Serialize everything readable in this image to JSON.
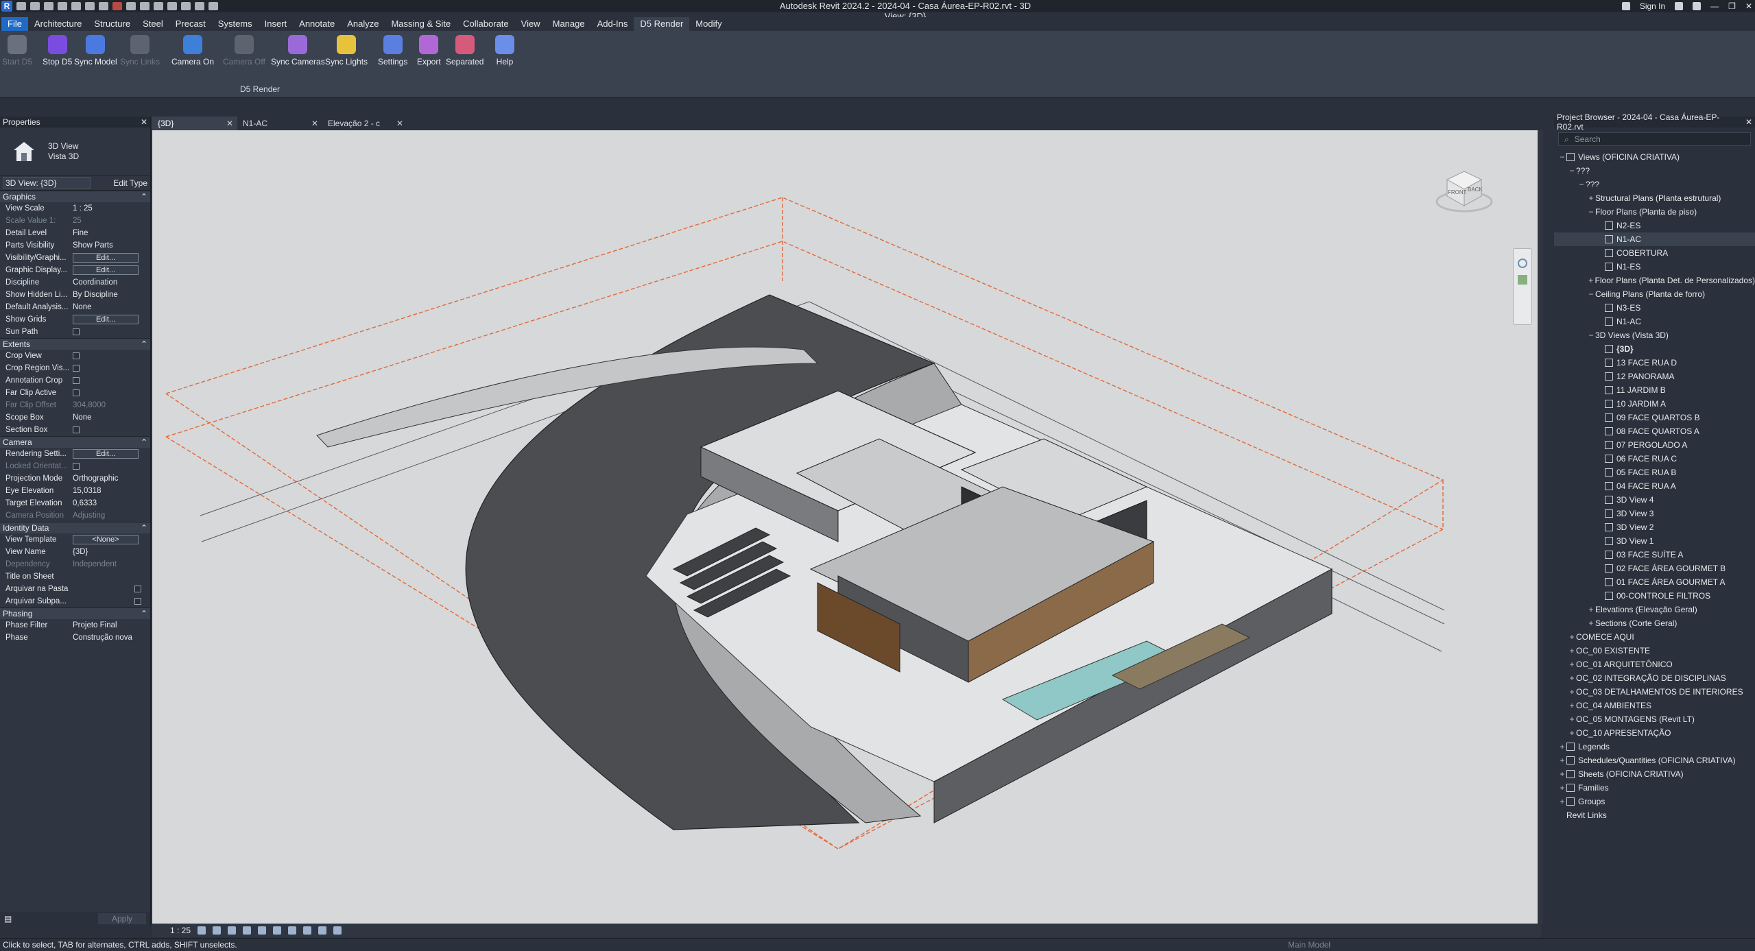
{
  "app": {
    "title": "Autodesk Revit 2024.2 - 2024-04 - Casa Áurea-EP-R02.rvt - 3D View: {3D}",
    "logo": "R",
    "sign_in": "Sign In"
  },
  "menu": [
    "File",
    "Architecture",
    "Structure",
    "Steel",
    "Precast",
    "Systems",
    "Insert",
    "Annotate",
    "Analyze",
    "Massing & Site",
    "Collaborate",
    "View",
    "Manage",
    "Add-Ins",
    "D5 Render",
    "Modify"
  ],
  "ribbon": {
    "panel_label": "D5 Render",
    "tools": [
      {
        "label": "Start D5",
        "enabled": false,
        "color": "#6a717c"
      },
      {
        "label": "Stop D5",
        "enabled": true,
        "color": "#7a4de0"
      },
      {
        "label": "Sync Model",
        "enabled": true,
        "color": "#4a7ae0"
      },
      {
        "label": "Sync Links",
        "enabled": false,
        "color": "#5d6470"
      },
      {
        "label": "Camera On",
        "enabled": true,
        "color": "#3d7fd9"
      },
      {
        "label": "Camera Off",
        "enabled": false,
        "color": "#5d6470"
      },
      {
        "label": "Sync Cameras",
        "enabled": true,
        "color": "#9a6bd8"
      },
      {
        "label": "Sync Lights",
        "enabled": true,
        "color": "#e7c23d"
      },
      {
        "label": "Settings",
        "enabled": true,
        "color": "#5b7fe0"
      },
      {
        "label": "Export",
        "enabled": true,
        "color": "#b168d6"
      },
      {
        "label": "Separated",
        "enabled": true,
        "color": "#d65a7a"
      },
      {
        "label": "Help",
        "enabled": true,
        "color": "#6b8ee8"
      }
    ]
  },
  "properties": {
    "header": "Properties",
    "type_line1": "3D View",
    "type_line2": "Vista 3D",
    "selector": "3D View: {3D}",
    "edit_type": "Edit Type",
    "groups": [
      {
        "name": "Graphics",
        "rows": [
          {
            "k": "View Scale",
            "v": "1 : 25",
            "dim": false,
            "kind": "text"
          },
          {
            "k": "Scale Value    1:",
            "v": "25",
            "dim": true,
            "kind": "text"
          },
          {
            "k": "Detail Level",
            "v": "Fine",
            "dim": false,
            "kind": "text"
          },
          {
            "k": "Parts Visibility",
            "v": "Show Parts",
            "dim": false,
            "kind": "text"
          },
          {
            "k": "Visibility/Graphi...",
            "v": "Edit...",
            "dim": false,
            "kind": "button"
          },
          {
            "k": "Graphic Display...",
            "v": "Edit...",
            "dim": false,
            "kind": "button"
          },
          {
            "k": "Discipline",
            "v": "Coordination",
            "dim": false,
            "kind": "text"
          },
          {
            "k": "Show Hidden Li...",
            "v": "By Discipline",
            "dim": false,
            "kind": "text"
          },
          {
            "k": "Default Analysis...",
            "v": "None",
            "dim": false,
            "kind": "text"
          },
          {
            "k": "Show Grids",
            "v": "Edit...",
            "dim": false,
            "kind": "button"
          },
          {
            "k": "Sun Path",
            "v": "",
            "dim": false,
            "kind": "check"
          }
        ]
      },
      {
        "name": "Extents",
        "rows": [
          {
            "k": "Crop View",
            "v": "",
            "dim": false,
            "kind": "check"
          },
          {
            "k": "Crop Region Vis...",
            "v": "",
            "dim": false,
            "kind": "check"
          },
          {
            "k": "Annotation Crop",
            "v": "",
            "dim": false,
            "kind": "check"
          },
          {
            "k": "Far Clip Active",
            "v": "",
            "dim": false,
            "kind": "check"
          },
          {
            "k": "Far Clip Offset",
            "v": "304,8000",
            "dim": true,
            "kind": "text"
          },
          {
            "k": "Scope Box",
            "v": "None",
            "dim": false,
            "kind": "text"
          },
          {
            "k": "Section Box",
            "v": "",
            "dim": false,
            "kind": "checkbox-box"
          }
        ]
      },
      {
        "name": "Camera",
        "rows": [
          {
            "k": "Rendering Setti...",
            "v": "Edit...",
            "dim": false,
            "kind": "button"
          },
          {
            "k": "Locked Orientat...",
            "v": "",
            "dim": true,
            "kind": "check"
          },
          {
            "k": "Projection Mode",
            "v": "Orthographic",
            "dim": false,
            "kind": "text"
          },
          {
            "k": "Eye Elevation",
            "v": "15,0318",
            "dim": false,
            "kind": "text"
          },
          {
            "k": "Target Elevation",
            "v": "0,6333",
            "dim": false,
            "kind": "text"
          },
          {
            "k": "Camera Position",
            "v": "Adjusting",
            "dim": true,
            "kind": "text"
          }
        ]
      },
      {
        "name": "Identity Data",
        "rows": [
          {
            "k": "View Template",
            "v": "<None>",
            "dim": false,
            "kind": "button"
          },
          {
            "k": "View Name",
            "v": "{3D}",
            "dim": false,
            "kind": "text"
          },
          {
            "k": "Dependency",
            "v": "Independent",
            "dim": true,
            "kind": "text"
          },
          {
            "k": "Title on Sheet",
            "v": "",
            "dim": false,
            "kind": "text"
          },
          {
            "k": "Arquivar na Pasta",
            "v": "",
            "dim": false,
            "kind": "check-right"
          },
          {
            "k": "Arquivar Subpa...",
            "v": "",
            "dim": false,
            "kind": "check-right"
          }
        ]
      },
      {
        "name": "Phasing",
        "rows": [
          {
            "k": "Phase Filter",
            "v": "Projeto Final",
            "dim": false,
            "kind": "text"
          },
          {
            "k": "Phase",
            "v": "Construção nova",
            "dim": false,
            "kind": "text"
          }
        ]
      }
    ],
    "apply": "Apply"
  },
  "view_tabs": [
    {
      "label": "{3D}",
      "active": true
    },
    {
      "label": "N1-AC",
      "active": false
    },
    {
      "label": "Elevação 2 - c",
      "active": false
    }
  ],
  "view_bar": {
    "scale": "1 : 25"
  },
  "browser": {
    "header": "Project Browser - 2024-04 - Casa Áurea-EP-R02.rvt",
    "search_placeholder": "Search",
    "nodes": [
      {
        "label": "Views (OFICINA CRIATIVA)",
        "level": 0,
        "toggle": "−",
        "icon": true
      },
      {
        "label": "???",
        "level": 1,
        "toggle": "−",
        "icon": false
      },
      {
        "label": "???",
        "level": 2,
        "toggle": "−",
        "icon": false
      },
      {
        "label": "Structural Plans (Planta estrutural)",
        "level": 3,
        "toggle": "+",
        "icon": false
      },
      {
        "label": "Floor Plans (Planta de piso)",
        "level": 3,
        "toggle": "−",
        "icon": false
      },
      {
        "label": "N2-ES",
        "level": 4,
        "toggle": "",
        "icon": true
      },
      {
        "label": "N1-AC",
        "level": 4,
        "toggle": "",
        "icon": true,
        "sel": true
      },
      {
        "label": "COBERTURA",
        "level": 4,
        "toggle": "",
        "icon": true
      },
      {
        "label": "N1-ES",
        "level": 4,
        "toggle": "",
        "icon": true
      },
      {
        "label": "Floor Plans (Planta Det. de Personalizados)",
        "level": 3,
        "toggle": "+",
        "icon": false
      },
      {
        "label": "Ceiling Plans (Planta de forro)",
        "level": 3,
        "toggle": "−",
        "icon": false
      },
      {
        "label": "N3-ES",
        "level": 4,
        "toggle": "",
        "icon": true
      },
      {
        "label": "N1-AC",
        "level": 4,
        "toggle": "",
        "icon": true
      },
      {
        "label": "3D Views (Vista 3D)",
        "level": 3,
        "toggle": "−",
        "icon": false
      },
      {
        "label": "{3D}",
        "level": 4,
        "toggle": "",
        "icon": true,
        "bold": true
      },
      {
        "label": "13 FACE RUA D",
        "level": 4,
        "toggle": "",
        "icon": true
      },
      {
        "label": "12 PANORAMA",
        "level": 4,
        "toggle": "",
        "icon": true
      },
      {
        "label": "11 JARDIM B",
        "level": 4,
        "toggle": "",
        "icon": true
      },
      {
        "label": "10 JARDIM A",
        "level": 4,
        "toggle": "",
        "icon": true
      },
      {
        "label": "09 FACE QUARTOS B",
        "level": 4,
        "toggle": "",
        "icon": true
      },
      {
        "label": "08 FACE QUARTOS A",
        "level": 4,
        "toggle": "",
        "icon": true
      },
      {
        "label": "07 PERGOLADO A",
        "level": 4,
        "toggle": "",
        "icon": true
      },
      {
        "label": "06 FACE RUA C",
        "level": 4,
        "toggle": "",
        "icon": true
      },
      {
        "label": "05 FACE RUA B",
        "level": 4,
        "toggle": "",
        "icon": true
      },
      {
        "label": "04 FACE RUA A",
        "level": 4,
        "toggle": "",
        "icon": true
      },
      {
        "label": "3D View 4",
        "level": 4,
        "toggle": "",
        "icon": true
      },
      {
        "label": "3D View 3",
        "level": 4,
        "toggle": "",
        "icon": true
      },
      {
        "label": "3D View 2",
        "level": 4,
        "toggle": "",
        "icon": true
      },
      {
        "label": "3D View 1",
        "level": 4,
        "toggle": "",
        "icon": true
      },
      {
        "label": "03 FACE SUÍTE A",
        "level": 4,
        "toggle": "",
        "icon": true
      },
      {
        "label": "02 FACE ÁREA GOURMET B",
        "level": 4,
        "toggle": "",
        "icon": true
      },
      {
        "label": "01 FACE ÁREA GOURMET A",
        "level": 4,
        "toggle": "",
        "icon": true
      },
      {
        "label": "00-CONTROLE FILTROS",
        "level": 4,
        "toggle": "",
        "icon": true
      },
      {
        "label": "Elevations (Elevação Geral)",
        "level": 3,
        "toggle": "+",
        "icon": false
      },
      {
        "label": "Sections (Corte Geral)",
        "level": 3,
        "toggle": "+",
        "icon": false
      },
      {
        "label": "COMECE AQUI",
        "level": 1,
        "toggle": "+",
        "icon": false
      },
      {
        "label": "OC_00 EXISTENTE",
        "level": 1,
        "toggle": "+",
        "icon": false
      },
      {
        "label": "OC_01 ARQUITETÔNICO",
        "level": 1,
        "toggle": "+",
        "icon": false
      },
      {
        "label": "OC_02 INTEGRAÇÃO DE DISCIPLINAS",
        "level": 1,
        "toggle": "+",
        "icon": false
      },
      {
        "label": "OC_03 DETALHAMENTOS DE INTERIORES",
        "level": 1,
        "toggle": "+",
        "icon": false
      },
      {
        "label": "OC_04 AMBIENTES",
        "level": 1,
        "toggle": "+",
        "icon": false
      },
      {
        "label": "OC_05 MONTAGENS (Revit LT)",
        "level": 1,
        "toggle": "+",
        "icon": false
      },
      {
        "label": "OC_10 APRESENTAÇÃO",
        "level": 1,
        "toggle": "+",
        "icon": false
      },
      {
        "label": "Legends",
        "level": 0,
        "toggle": "+",
        "icon": true
      },
      {
        "label": "Schedules/Quantities (OFICINA CRIATIVA)",
        "level": 0,
        "toggle": "+",
        "icon": true
      },
      {
        "label": "Sheets (OFICINA CRIATIVA)",
        "level": 0,
        "toggle": "+",
        "icon": true
      },
      {
        "label": "Families",
        "level": 0,
        "toggle": "+",
        "icon": true
      },
      {
        "label": "Groups",
        "level": 0,
        "toggle": "+",
        "icon": true
      },
      {
        "label": "Revit Links",
        "level": 0,
        "toggle": "",
        "icon": false
      }
    ]
  },
  "status": {
    "message": "Click to select, TAB for alternates, CTRL adds, SHIFT unselects.",
    "model": "Main Model"
  },
  "viewcube": {
    "front": "FRONT",
    "back": "BACK"
  }
}
